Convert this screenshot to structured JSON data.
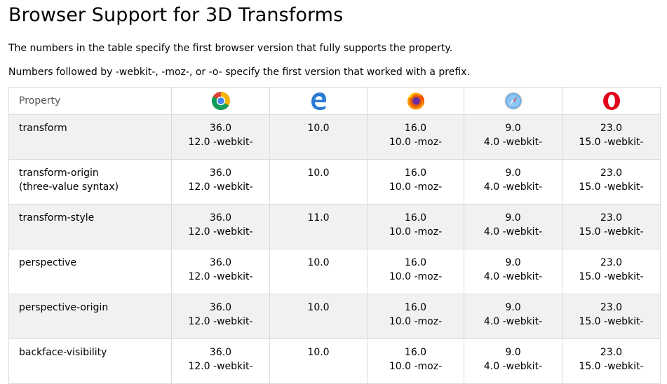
{
  "page": {
    "title": "Browser Support for 3D Transforms",
    "note1": "The numbers in the table specify the first browser version that fully supports the property.",
    "note2": "Numbers followed by -webkit-, -moz-, or -o- specify the first version that worked with a prefix."
  },
  "table": {
    "header": {
      "property": "Property",
      "browsers": [
        {
          "icon": "chrome-icon",
          "color": "#4caf50"
        },
        {
          "icon": "edge-icon",
          "color": "#2a7bd4"
        },
        {
          "icon": "firefox-icon",
          "color": "#e66000"
        },
        {
          "icon": "safari-icon",
          "color": "#4a90d9"
        },
        {
          "icon": "opera-icon",
          "color": "#e3001b"
        }
      ]
    },
    "rows": [
      {
        "property": [
          "transform"
        ],
        "chrome": [
          "36.0",
          "12.0 -webkit-"
        ],
        "edge": [
          "10.0"
        ],
        "firefox": [
          "16.0",
          "10.0 -moz-"
        ],
        "safari": [
          "9.0",
          "4.0 -webkit-"
        ],
        "opera": [
          "23.0",
          "15.0 -webkit-"
        ]
      },
      {
        "property": [
          "transform-origin",
          "(three-value syntax)"
        ],
        "chrome": [
          "36.0",
          "12.0 -webkit-"
        ],
        "edge": [
          "10.0"
        ],
        "firefox": [
          "16.0",
          "10.0 -moz-"
        ],
        "safari": [
          "9.0",
          "4.0 -webkit-"
        ],
        "opera": [
          "23.0",
          "15.0 -webkit-"
        ]
      },
      {
        "property": [
          "transform-style"
        ],
        "chrome": [
          "36.0",
          "12.0 -webkit-"
        ],
        "edge": [
          "11.0"
        ],
        "firefox": [
          "16.0",
          "10.0 -moz-"
        ],
        "safari": [
          "9.0",
          "4.0 -webkit-"
        ],
        "opera": [
          "23.0",
          "15.0 -webkit-"
        ]
      },
      {
        "property": [
          "perspective"
        ],
        "chrome": [
          "36.0",
          "12.0 -webkit-"
        ],
        "edge": [
          "10.0"
        ],
        "firefox": [
          "16.0",
          "10.0 -moz-"
        ],
        "safari": [
          "9.0",
          "4.0 -webkit-"
        ],
        "opera": [
          "23.0",
          "15.0 -webkit-"
        ]
      },
      {
        "property": [
          "perspective-origin"
        ],
        "chrome": [
          "36.0",
          "12.0 -webkit-"
        ],
        "edge": [
          "10.0"
        ],
        "firefox": [
          "16.0",
          "10.0 -moz-"
        ],
        "safari": [
          "9.0",
          "4.0 -webkit-"
        ],
        "opera": [
          "23.0",
          "15.0 -webkit-"
        ]
      },
      {
        "property": [
          "backface-visibility"
        ],
        "chrome": [
          "36.0",
          "12.0 -webkit-"
        ],
        "edge": [
          "10.0"
        ],
        "firefox": [
          "16.0",
          "10.0 -moz-"
        ],
        "safari": [
          "9.0",
          "4.0 -webkit-"
        ],
        "opera": [
          "23.0",
          "15.0 -webkit-"
        ]
      }
    ]
  }
}
